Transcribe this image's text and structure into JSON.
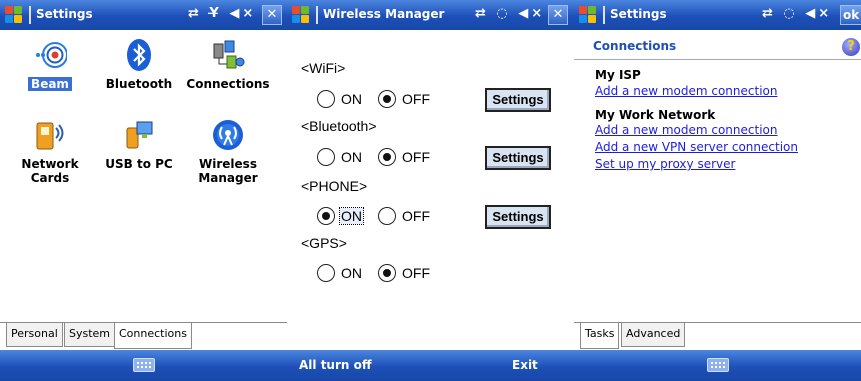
{
  "screen1": {
    "title": "Settings",
    "status_icons": "⇄ Y̶ ◀×",
    "close_label": "✕",
    "items": [
      {
        "label": "Beam",
        "icon": "beam-icon"
      },
      {
        "label": "Bluetooth",
        "icon": "bluetooth-icon"
      },
      {
        "label": "Connections",
        "icon": "connections-icon"
      },
      {
        "label": "Network",
        "label2": "Cards",
        "icon": "network-cards-icon"
      },
      {
        "label": "USB to PC",
        "icon": "usb-to-pc-icon"
      },
      {
        "label": "Wireless",
        "label2": "Manager",
        "icon": "wireless-manager-icon"
      }
    ],
    "tabs": [
      "Personal",
      "System",
      "Connections"
    ]
  },
  "screen2": {
    "title": "Wireless Manager",
    "status_icons": "⇄ ◌ ◀×",
    "close_label": "✕",
    "sections": [
      {
        "label": "<WiFi>",
        "on": "ON",
        "off": "OFF",
        "selected": "off",
        "settings": "Settings"
      },
      {
        "label": "<Bluetooth>",
        "on": "ON",
        "off": "OFF",
        "selected": "off",
        "settings": "Settings"
      },
      {
        "label": "<PHONE>",
        "on": "ON",
        "off": "OFF",
        "selected": "on",
        "settings": "Settings"
      },
      {
        "label": "<GPS>",
        "on": "ON",
        "off": "OFF",
        "selected": "off"
      }
    ],
    "left_softkey": "All turn off",
    "right_softkey": "Exit"
  },
  "screen3": {
    "title": "Settings",
    "status_icons": "⇄ ◌ ◀×",
    "ok_label": "ok",
    "header": "Connections",
    "help_label": "?",
    "groups": [
      {
        "name": "My ISP",
        "links": [
          "Add a new modem connection"
        ]
      },
      {
        "name": "My Work Network",
        "links": [
          "Add a new modem connection",
          "Add a new VPN server connection",
          "Set up my proxy server"
        ]
      }
    ],
    "tabs": [
      "Tasks",
      "Advanced"
    ]
  },
  "colors": {
    "titlebar": "#1d4fb8",
    "link": "#1d1de0",
    "header_text": "#1f4fb3",
    "selection": "#3a6fd5"
  }
}
